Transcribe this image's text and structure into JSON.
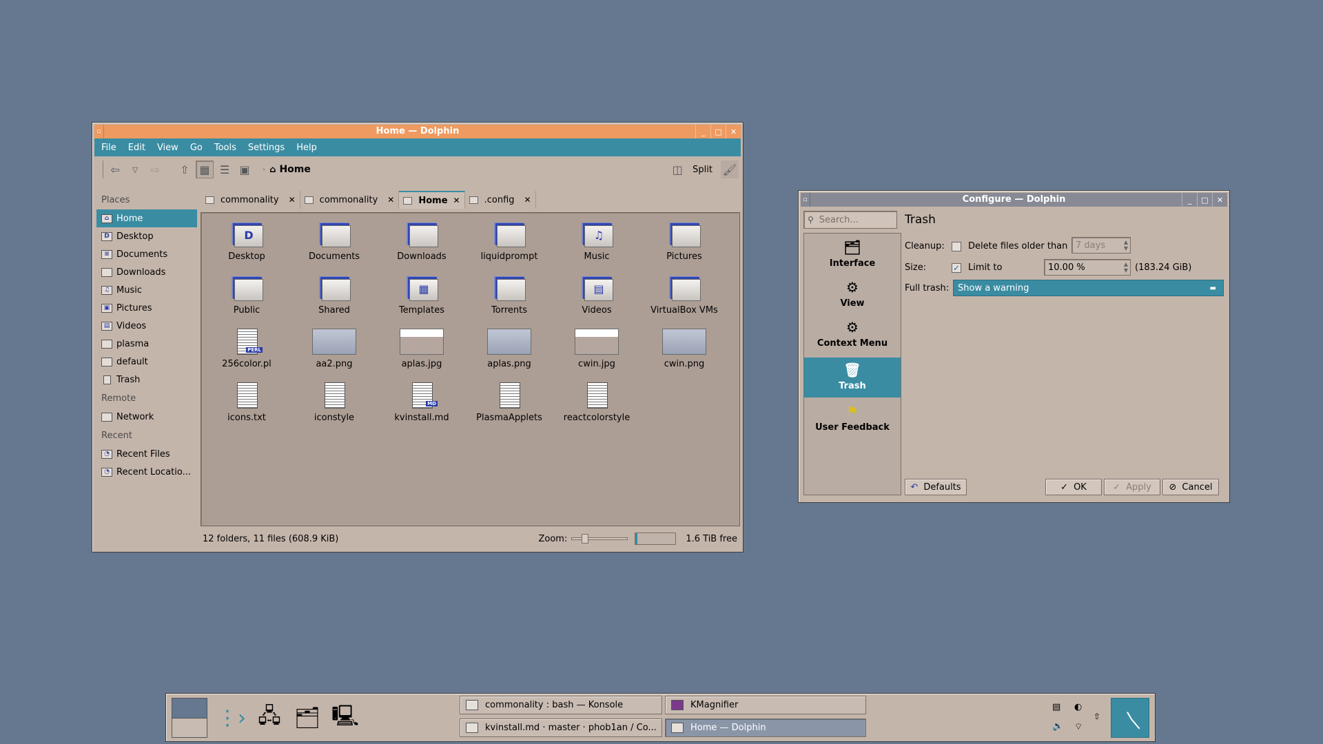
{
  "dolphin": {
    "title": "Home — Dolphin",
    "menu": [
      "File",
      "Edit",
      "View",
      "Go",
      "Tools",
      "Settings",
      "Help"
    ],
    "breadcrumb": "Home",
    "split_label": "Split",
    "places_header": "Places",
    "places": [
      "Home",
      "Desktop",
      "Documents",
      "Downloads",
      "Music",
      "Pictures",
      "Videos",
      "plasma",
      "default",
      "Trash"
    ],
    "remote_header": "Remote",
    "remote": [
      "Network"
    ],
    "recent_header": "Recent",
    "recent": [
      "Recent Files",
      "Recent Locatio..."
    ],
    "tabs": [
      "commonality",
      "commonality",
      "Home",
      ".config"
    ],
    "active_tab_index": 2,
    "items": [
      {
        "name": "Desktop",
        "kind": "folder",
        "glyph": "D"
      },
      {
        "name": "Documents",
        "kind": "folder",
        "glyph": ""
      },
      {
        "name": "Downloads",
        "kind": "folder",
        "glyph": ""
      },
      {
        "name": "liquidprompt",
        "kind": "folder",
        "glyph": ""
      },
      {
        "name": "Music",
        "kind": "folder",
        "glyph": "♫"
      },
      {
        "name": "Pictures",
        "kind": "folder",
        "glyph": ""
      },
      {
        "name": "Public",
        "kind": "folder",
        "glyph": ""
      },
      {
        "name": "Shared",
        "kind": "folder",
        "glyph": ""
      },
      {
        "name": "Templates",
        "kind": "folder",
        "glyph": "▦"
      },
      {
        "name": "Torrents",
        "kind": "folder",
        "glyph": ""
      },
      {
        "name": "Videos",
        "kind": "folder",
        "glyph": "▤"
      },
      {
        "name": "VirtualBox VMs",
        "kind": "folder",
        "glyph": ""
      },
      {
        "name": "256color.pl",
        "kind": "doc",
        "badge": "PERL"
      },
      {
        "name": "aa2.png",
        "kind": "thumb"
      },
      {
        "name": "aplas.jpg",
        "kind": "thumb-light"
      },
      {
        "name": "aplas.png",
        "kind": "thumb"
      },
      {
        "name": "cwin.jpg",
        "kind": "thumb-light"
      },
      {
        "name": "cwin.png",
        "kind": "thumb"
      },
      {
        "name": "icons.txt",
        "kind": "doc"
      },
      {
        "name": "iconstyle",
        "kind": "doc"
      },
      {
        "name": "kvinstall.md",
        "kind": "doc",
        "badge": "MD"
      },
      {
        "name": "PlasmaApplets",
        "kind": "doc"
      },
      {
        "name": "reactcolorstyle",
        "kind": "doc"
      }
    ],
    "status_text": "12 folders, 11 files (608.9 KiB)",
    "zoom_label": "Zoom:",
    "free_space": "1.6 TiB free",
    "disk_used_fraction": 0.05
  },
  "configure": {
    "title": "Configure — Dolphin",
    "search_placeholder": "Search...",
    "categories": [
      "Interface",
      "View",
      "Context Menu",
      "Trash",
      "User Feedback"
    ],
    "selected_category": "Trash",
    "page_title": "Trash",
    "cleanup_label": "Cleanup:",
    "cleanup_checkbox_label": "Delete files older than",
    "cleanup_checked": false,
    "cleanup_value": "7 days",
    "size_label": "Size:",
    "size_checkbox_label": "Limit to",
    "size_checked": true,
    "size_value": "10.00 %",
    "size_computed": "(183.24 GiB)",
    "full_trash_label": "Full trash:",
    "full_trash_value": "Show a warning",
    "buttons": {
      "defaults": "Defaults",
      "ok": "OK",
      "apply": "Apply",
      "cancel": "Cancel"
    }
  },
  "taskbar": {
    "tasks": [
      {
        "label": "commonality : bash — Konsole",
        "active": false
      },
      {
        "label": "KMagnifier",
        "active": false
      },
      {
        "label": "kvinstall.md · master · phob1an / Co...",
        "active": false
      },
      {
        "label": "Home — Dolphin",
        "active": true
      }
    ]
  },
  "colors": {
    "accent": "#3a8ca2",
    "active_title": "#ee9a60",
    "inactive_title": "#878a94",
    "desktop": "#657890",
    "window": "#c4b5ab"
  }
}
